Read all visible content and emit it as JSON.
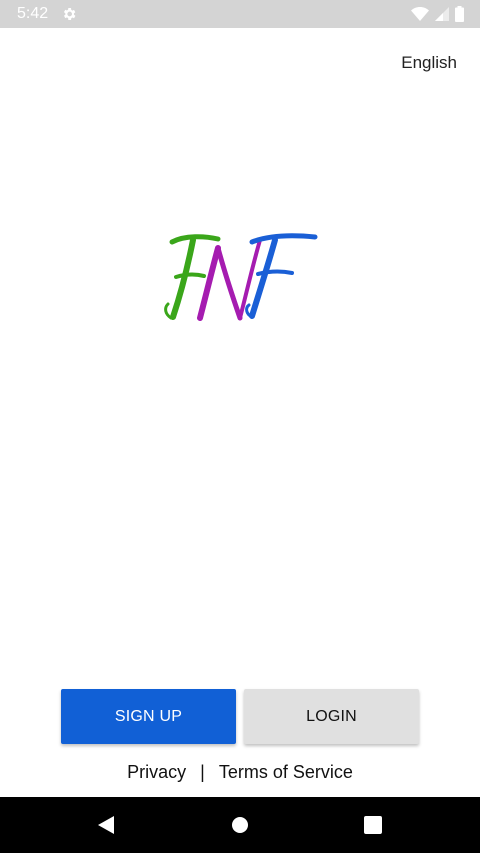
{
  "status_bar": {
    "time": "5:42",
    "icons": [
      "gear-icon",
      "wifi-icon",
      "signal-icon",
      "battery-icon"
    ]
  },
  "header": {
    "language": "English"
  },
  "logo": {
    "text": "FNF",
    "letter_colors": [
      "#3aa61a",
      "#a51cb0",
      "#1a5fd6"
    ]
  },
  "actions": {
    "signup_label": "SIGN UP",
    "login_label": "LOGIN"
  },
  "footer": {
    "privacy": "Privacy",
    "separator": "|",
    "terms": "Terms of Service"
  },
  "nav_bar": {
    "icons": [
      "back-icon",
      "home-icon",
      "recents-icon"
    ]
  },
  "colors": {
    "primary": "#1160d6",
    "secondary_button": "#e0e0e0",
    "status_bar": "#d4d4d4",
    "nav_bar": "#000000"
  }
}
